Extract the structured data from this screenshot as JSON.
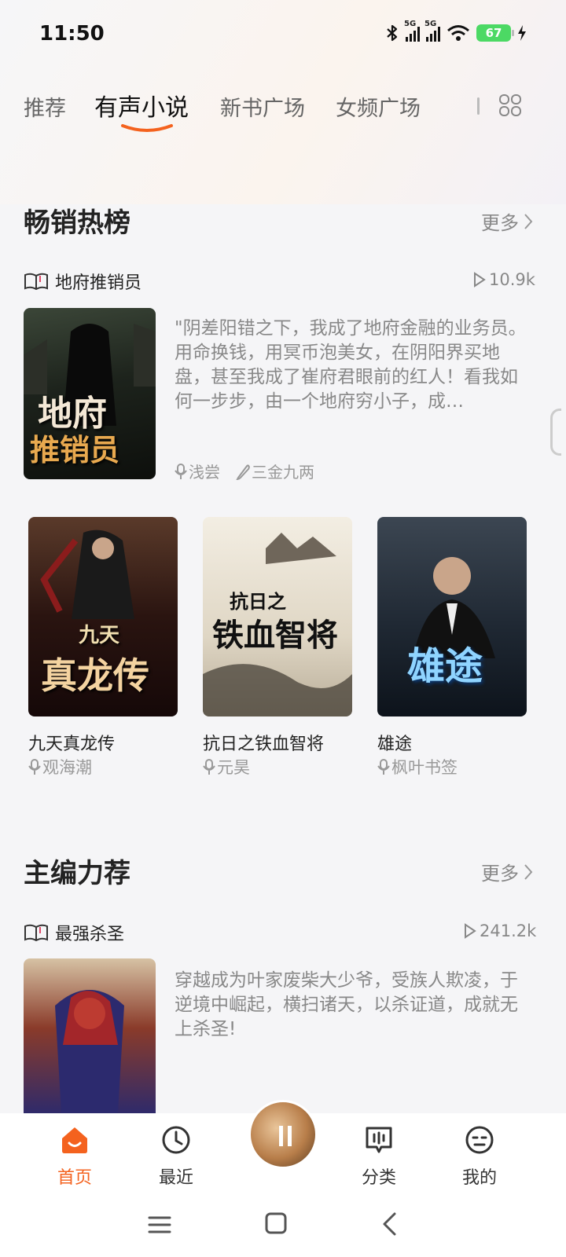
{
  "status_bar": {
    "time": "11:50",
    "battery": "67",
    "net1": "5G",
    "net2": "5G"
  },
  "tabs": [
    {
      "label": "推荐",
      "active": false
    },
    {
      "label": "有声小说",
      "active": true
    },
    {
      "label": "新书广场",
      "active": false
    },
    {
      "label": "女频广场",
      "active": false
    }
  ],
  "bestseller": {
    "title": "畅销热榜",
    "more": "更多",
    "featured": {
      "title": "地府推销员",
      "plays": "10.9k",
      "cover_text_1": "地府",
      "cover_text_2": "推销员",
      "description": "\"阴差阳错之下，我成了地府金融的业务员。用命换钱，用冥币泡美女，在阴阳界买地盘，甚至我成了崔府君眼前的红人！看我如何一步步，由一个地府穷小子，成…",
      "narrator": "浅尝",
      "author": "三金九两"
    },
    "grid": [
      {
        "title": "九天真龙传",
        "narrator": "观海潮",
        "cover_text_1": "九天",
        "cover_text_2": "真龙传"
      },
      {
        "title": "抗日之铁血智将",
        "narrator": "元昊",
        "cover_text_1": "抗日之",
        "cover_text_2": "铁血智将"
      },
      {
        "title": "雄途",
        "narrator": "枫叶书签",
        "cover_text_1": "",
        "cover_text_2": "雄途"
      }
    ]
  },
  "editor_pick": {
    "title": "主编力荐",
    "more": "更多",
    "featured": {
      "title": "最强杀圣",
      "plays": "241.2k",
      "description": "穿越成为叶家废柴大少爷，受族人欺凌，于逆境中崛起，横扫诸天，以杀证道，成就无上杀圣!"
    }
  },
  "bottom_nav": [
    {
      "label": "首页",
      "icon": "home-icon",
      "active": true
    },
    {
      "label": "最近",
      "icon": "clock-icon",
      "active": false
    },
    {
      "label": "分类",
      "icon": "category-icon",
      "active": false
    },
    {
      "label": "我的",
      "icon": "profile-icon",
      "active": false
    }
  ],
  "colors": {
    "accent": "#f4621e",
    "background": "#f5f5f7"
  }
}
